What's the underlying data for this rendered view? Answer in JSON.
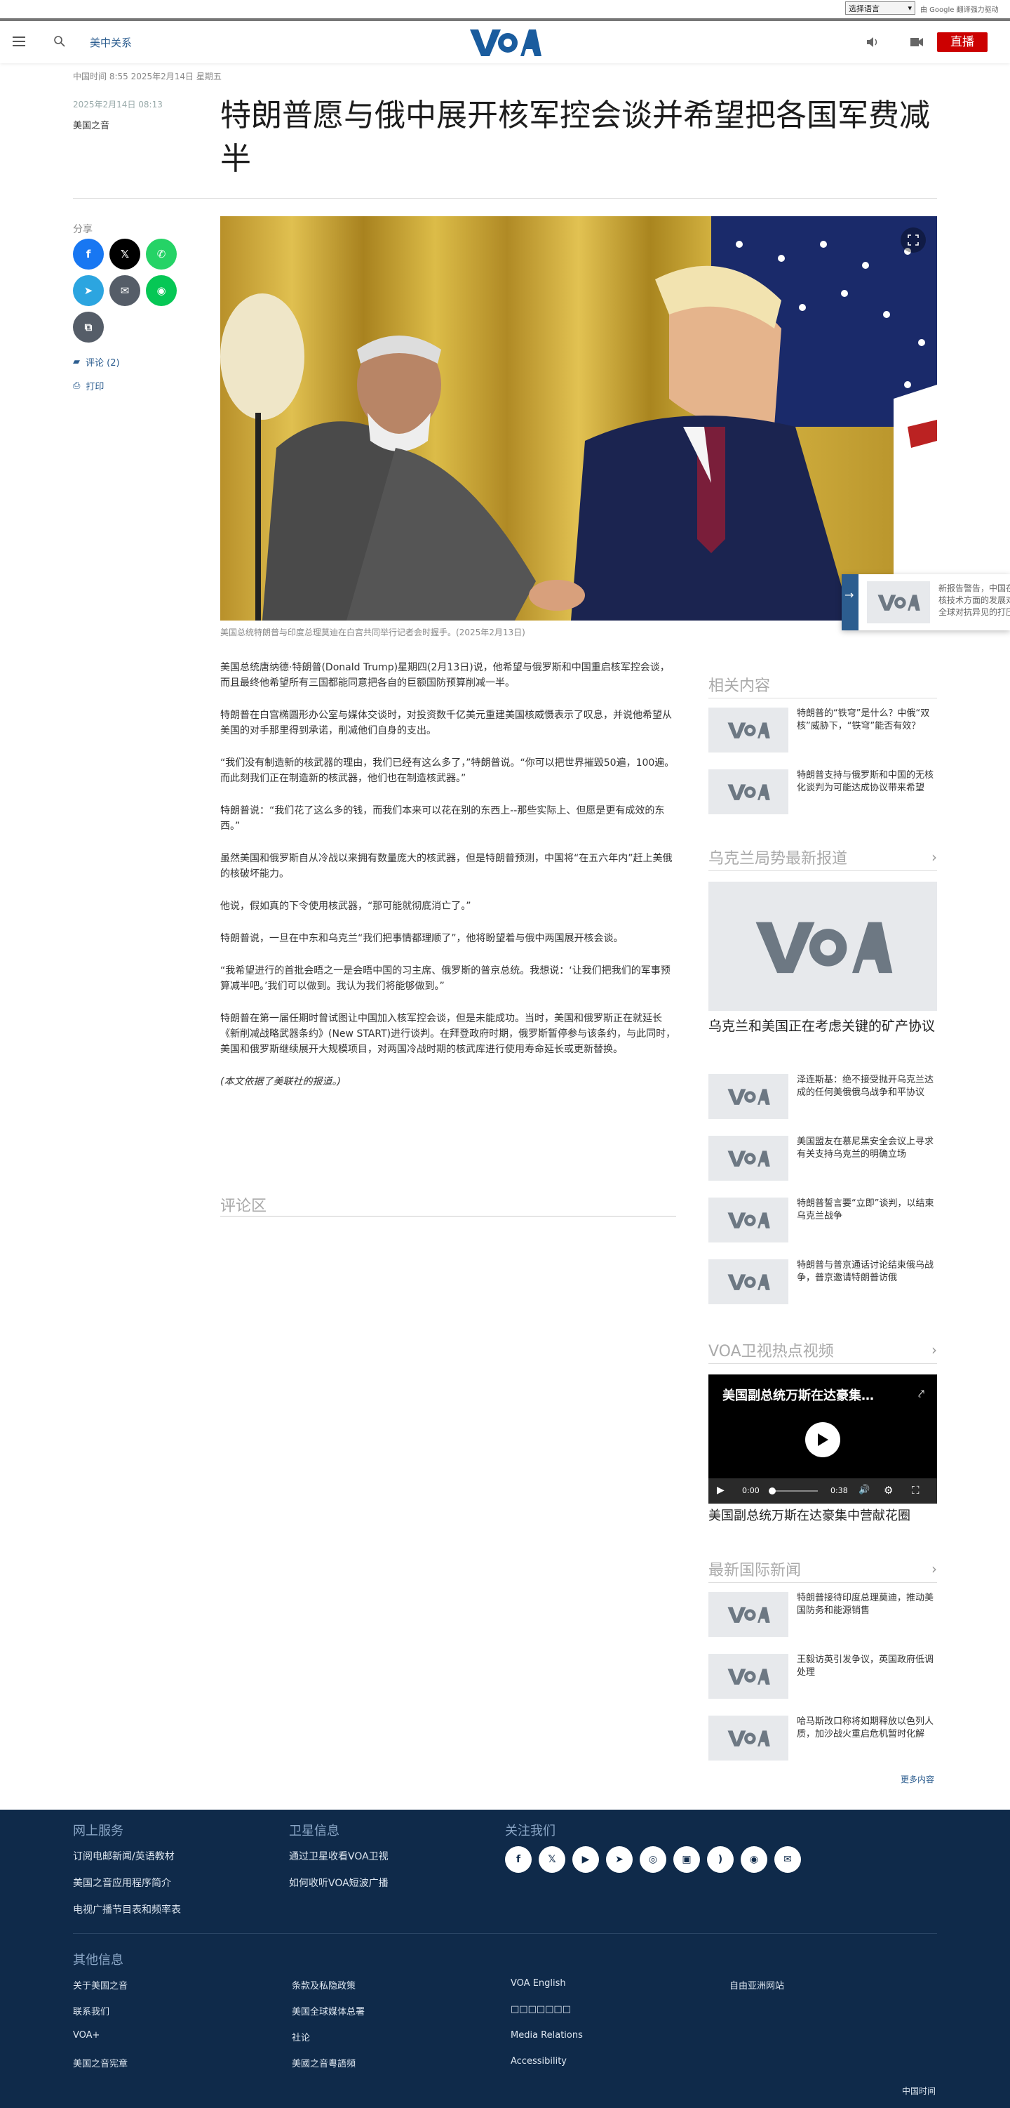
{
  "topbar": {
    "language_select": "选择语言",
    "google_translate": "由 Google 翻译强力驱动"
  },
  "header": {
    "section": "美中关系",
    "live_label": "直播"
  },
  "article": {
    "timebar": "中国时间 8:55 2025年2月14日 星期五",
    "date": "2025年2月14日 08:13",
    "source": "美国之音",
    "title": "特朗普愿与俄中展开核军控会谈并希望把各国军费减半",
    "share_label": "分享",
    "comments_link": "评论 (2)",
    "print_link": "打印",
    "caption": "美国总统特朗普与印度总理莫迪在白宫共同举行记者会时握手。(2025年2月13日)",
    "paragraphs": [
      "美国总统唐纳德·特朗普(Donald Trump)星期四(2月13日)说，他希望与俄罗斯和中国重启核军控会谈，而且最终他希望所有三国都能同意把各自的巨额国防预算削减一半。",
      "特朗普在白宫椭圆形办公室与媒体交谈时，对投资数千亿美元重建美国核威慑表示了叹息，并说他希望从美国的对手那里得到承诺，削减他们自身的支出。",
      "“我们没有制造新的核武器的理由，我们已经有这么多了，”特朗普说。“你可以把世界摧毁50遍，100遍。而此刻我们正在制造新的核武器，他们也在制造核武器。”",
      "特朗普说：“我们花了这么多的钱，而我们本来可以花在别的东西上--那些实际上、但愿是更有成效的东西。”",
      "虽然美国和俄罗斯自从冷战以来拥有数量庞大的核武器，但是特朗普预测，中国将“在五六年内”赶上美俄的核破坏能力。",
      "他说，假如真的下令使用核武器，“那可能就彻底消亡了。”",
      "特朗普说，一旦在中东和乌克兰“我们把事情都理顺了”，他将盼望着与俄中两国展开核会谈。",
      "“我希望进行的首批会晤之一是会晤中国的习主席、俄罗斯的普京总统。我想说：‘让我们把我们的军事预算减半吧。’我们可以做到。我认为我们将能够做到。”",
      "特朗普在第一届任期时曾试图让中国加入核军控会谈，但是未能成功。当时，美国和俄罗斯正在就延长《新削减战略武器条约》(New START)进行谈判。在拜登政府时期，俄罗斯暂停参与该条约，与此同时，美国和俄罗斯继续展开大规模项目，对两国冷战时期的核武库进行使用寿命延长或更新替换。"
    ],
    "note": "(本文依据了美联社的报道。)",
    "comments_title": "评论区"
  },
  "popup": {
    "text": "新报告警告，中国在核技术方面的发展对全球对抗异见的打压"
  },
  "rail": {
    "related": {
      "title": "相关内容",
      "items": [
        "特朗普的“铁穹”是什么？中俄“双核”威胁下，“铁穹”能否有效？",
        "特朗普支持与俄罗斯和中国的无核化谈判为可能达成协议带来希望"
      ]
    },
    "ukraine": {
      "title": "乌克兰局势最新报道",
      "feature": "乌克兰和美国正在考虑关键的矿产协议",
      "items": [
        "泽连斯基：绝不接受抛开乌克兰达成的任何美俄俄乌战争和平协议",
        "美国盟友在慕尼黑安全会议上寻求有关支持乌克兰的明确立场",
        "特朗普誓言要“立即”谈判，以结束乌克兰战争",
        "特朗普与普京通话讨论结束俄乌战争，普京邀请特朗普访俄"
      ]
    },
    "video": {
      "title": "VOA卫视热点视频",
      "video_title": "美国副总统万斯在达豪集…",
      "time_current": "0:00",
      "time_total": "0:38",
      "caption": "美国副总统万斯在达豪集中营献花圈"
    },
    "intl": {
      "title": "最新国际新闻",
      "items": [
        "特朗普接待印度总理莫迪，推动美国防务和能源销售",
        "王毅访英引发争议，英国政府低调处理",
        "哈马斯改口称将如期释放以色列人质，加沙战火重启危机暂时化解"
      ],
      "more": "更多内容"
    }
  },
  "footer": {
    "online_title": "网上服务",
    "online_links": [
      "订阅电邮新闻/英语教材",
      "美国之音应用程序简介",
      "电视广播节目表和频率表"
    ],
    "satellite_title": "卫星信息",
    "satellite_links": [
      "通过卫星收看VOA卫视",
      "如何收听VOA短波广播"
    ],
    "follow_title": "关注我们",
    "other_title": "其他信息",
    "col1": [
      "关于美国之音",
      "联系我们",
      "VOA+",
      "美国之音宪章"
    ],
    "col2": [
      "条款及私隐政策",
      "美国全球媒体总署",
      "社论",
      "美國之音粵語頻"
    ],
    "col3": [
      "VOA English",
      "□□□□□□□",
      "Media Relations",
      "Accessibility"
    ],
    "col4": [
      "自由亚洲网站"
    ],
    "time_label": "中国时间"
  }
}
